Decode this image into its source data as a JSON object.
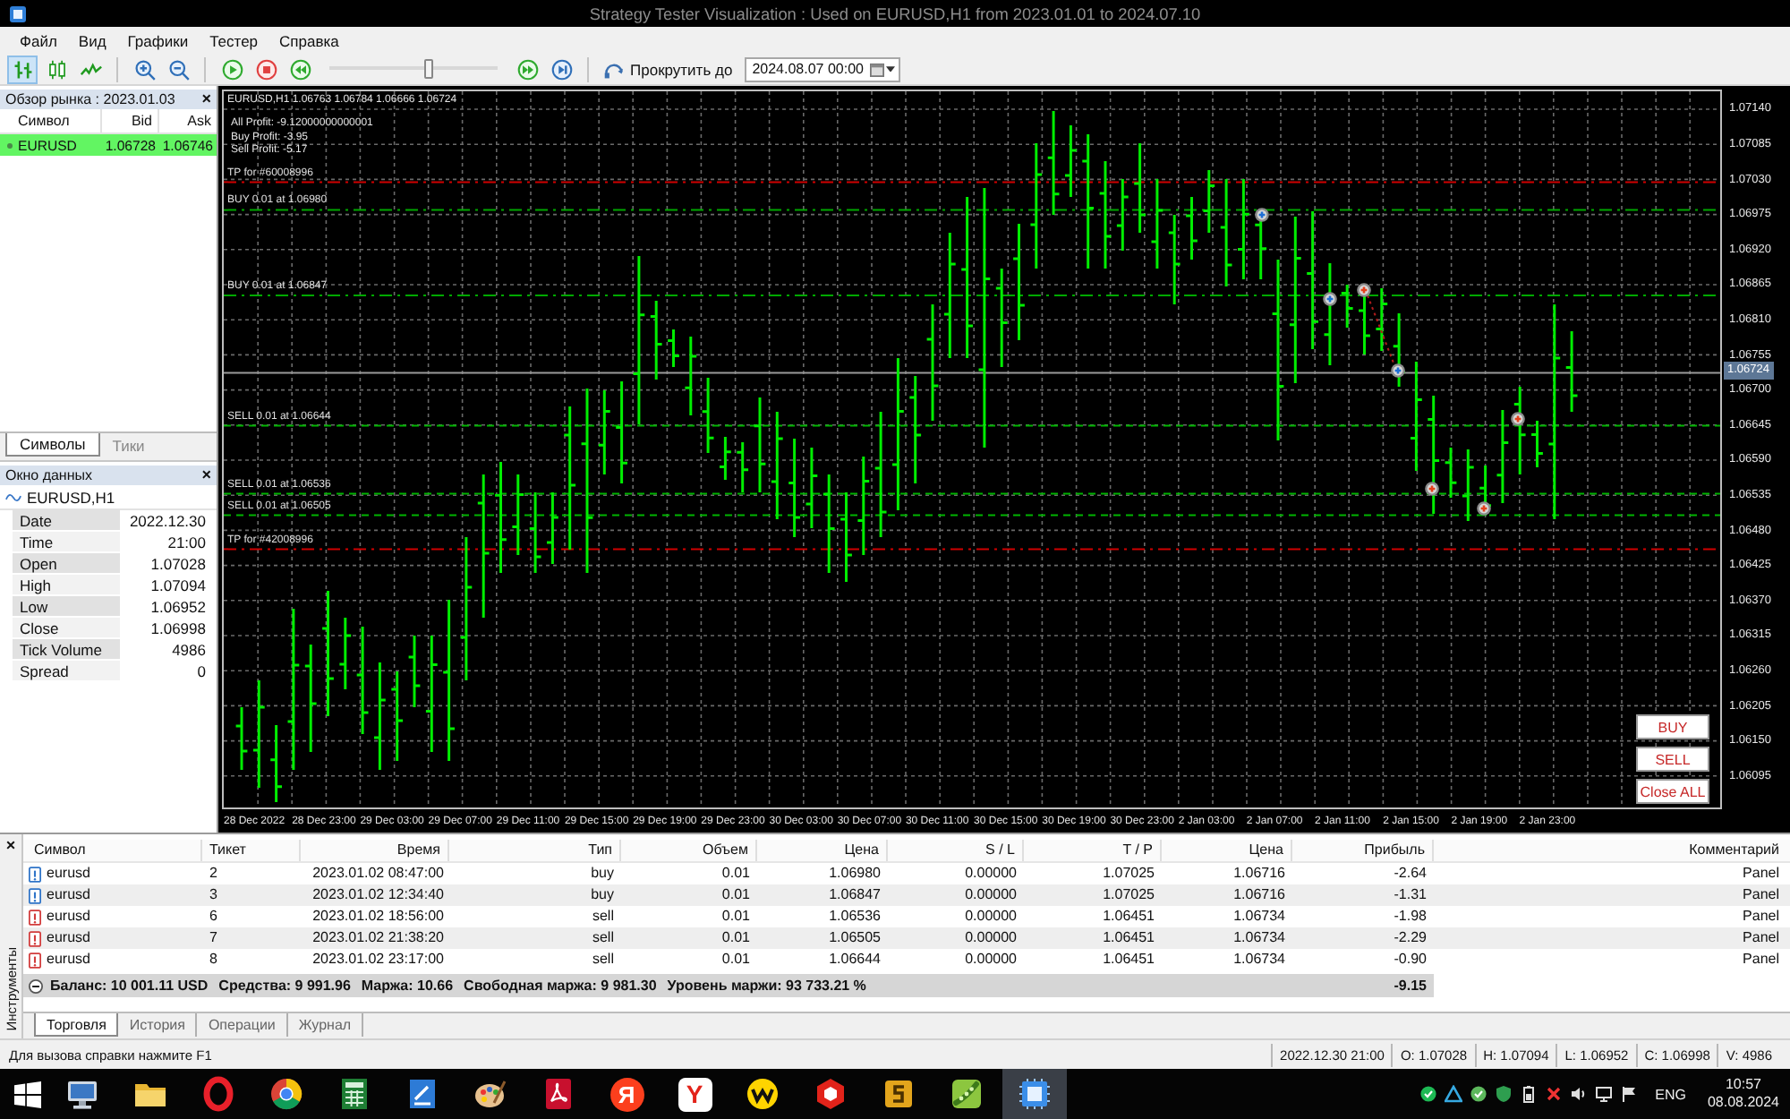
{
  "window": {
    "title": "Strategy Tester Visualization : Used on EURUSD,H1 from 2023.01.01 to 2024.07.10"
  },
  "menu": [
    "Файл",
    "Вид",
    "Графики",
    "Тестер",
    "Справка"
  ],
  "toolbar": {
    "chart_modes": [
      {
        "kind": "bars",
        "selected": true
      },
      {
        "kind": "candles",
        "selected": false
      },
      {
        "kind": "line",
        "selected": false
      }
    ],
    "speed": {
      "level": 0.6
    },
    "scroll_to": {
      "label": "Прокрутить до",
      "value": "2024.08.07 00:00"
    }
  },
  "market_watch": {
    "title": "Обзор рынка : 2023.01.03",
    "close": "×",
    "columns": [
      "Символ",
      "Bid",
      "Ask"
    ],
    "rows": [
      {
        "symbol": "EURUSD",
        "bid": "1.06728",
        "ask": "1.06746",
        "selected": true
      }
    ],
    "tabs": [
      {
        "label": "Символы",
        "selected": true
      },
      {
        "label": "Тики",
        "selected": false
      }
    ]
  },
  "data_window": {
    "title": "Окно данных",
    "close": "×",
    "symbol": "EURUSD,H1",
    "rows": [
      {
        "label": "Date",
        "value": "2022.12.30"
      },
      {
        "label": "Time",
        "value": "21:00"
      },
      {
        "label": "Open",
        "value": "1.07028"
      },
      {
        "label": "High",
        "value": "1.07094"
      },
      {
        "label": "Low",
        "value": "1.06952"
      },
      {
        "label": "Close",
        "value": "1.06998"
      },
      {
        "label": "Tick Volume",
        "value": "4986"
      },
      {
        "label": "Spread",
        "value": "0"
      }
    ]
  },
  "chart": {
    "header": "EURUSD,H1 1.06763 1.06784 1.06666 1.06724",
    "profit_lines": [
      "All Profit: -9.12000000000001",
      "Buy Profit: -3.95",
      "Sell Profit: -5.17"
    ],
    "order_lines": [
      {
        "kind": "tp",
        "label": "TP for #60008996"
      },
      {
        "kind": "buy",
        "label": "BUY 0.01 at 1.06980"
      },
      {
        "kind": "buy",
        "label": "BUY 0.01 at 1.06847"
      },
      {
        "kind": "sell",
        "label": "SELL 0.01 at 1.06644"
      },
      {
        "kind": "sell",
        "label": "SELL 0.01 at 1.06536"
      },
      {
        "kind": "sell",
        "label": "SELL 0.01 at 1.06505"
      },
      {
        "kind": "tp",
        "label": "TP for #42008996"
      }
    ],
    "current_price": "1.06724",
    "price_labels": [
      "1.07140",
      "1.07085",
      "1.07030",
      "1.06975",
      "1.06920",
      "1.06865",
      "1.06810",
      "1.06755",
      "1.06700",
      "1.06645",
      "1.06590",
      "1.06535",
      "1.06480",
      "1.06425",
      "1.06370",
      "1.06315",
      "1.06260",
      "1.06205",
      "1.06150",
      "1.06095"
    ],
    "time_labels": [
      "28 Dec 2022",
      "28 Dec 23:00",
      "29 Dec 03:00",
      "29 Dec 07:00",
      "29 Dec 11:00",
      "29 Dec 15:00",
      "29 Dec 19:00",
      "29 Dec 23:00",
      "30 Dec 03:00",
      "30 Dec 07:00",
      "30 Dec 11:00",
      "30 Dec 15:00",
      "30 Dec 19:00",
      "30 Dec 23:00",
      "2 Jan 03:00",
      "2 Jan 07:00",
      "2 Jan 11:00",
      "2 Jan 15:00",
      "2 Jan 19:00",
      "2 Jan 23:00"
    ],
    "buttons": [
      "BUY",
      "SELL",
      "Close ALL"
    ]
  },
  "terminal": {
    "close": "×",
    "side_label": "Инструменты",
    "columns": [
      "Символ",
      "Тикет",
      "Время",
      "Тип",
      "Объем",
      "Цена",
      "S / L",
      "T / P",
      "Цена",
      "Прибыль",
      "Комментарий"
    ],
    "rows": [
      {
        "kind": "buy",
        "symbol": "eurusd",
        "ticket": "2",
        "time": "2023.01.02 08:47:00",
        "type": "buy",
        "volume": "0.01",
        "price": "1.06980",
        "sl": "0.00000",
        "tp": "1.07025",
        "current_price": "1.06716",
        "profit": "-2.64",
        "comment": "Panel"
      },
      {
        "kind": "buy",
        "symbol": "eurusd",
        "ticket": "3",
        "time": "2023.01.02 12:34:40",
        "type": "buy",
        "volume": "0.01",
        "price": "1.06847",
        "sl": "0.00000",
        "tp": "1.07025",
        "current_price": "1.06716",
        "profit": "-1.31",
        "comment": "Panel"
      },
      {
        "kind": "sell",
        "symbol": "eurusd",
        "ticket": "6",
        "time": "2023.01.02 18:56:00",
        "type": "sell",
        "volume": "0.01",
        "price": "1.06536",
        "sl": "0.00000",
        "tp": "1.06451",
        "current_price": "1.06734",
        "profit": "-1.98",
        "comment": "Panel"
      },
      {
        "kind": "sell",
        "symbol": "eurusd",
        "ticket": "7",
        "time": "2023.01.02 21:38:20",
        "type": "sell",
        "volume": "0.01",
        "price": "1.06505",
        "sl": "0.00000",
        "tp": "1.06451",
        "current_price": "1.06734",
        "profit": "-2.29",
        "comment": "Panel"
      },
      {
        "kind": "sell",
        "symbol": "eurusd",
        "ticket": "8",
        "time": "2023.01.02 23:17:00",
        "type": "sell",
        "volume": "0.01",
        "price": "1.06644",
        "sl": "0.00000",
        "tp": "1.06451",
        "current_price": "1.06734",
        "profit": "-0.90",
        "comment": "Panel"
      }
    ],
    "summary": [
      "Баланс: 10 001.11 USD",
      "Средства: 9 991.96",
      "Маржа: 10.66",
      "Свободная маржа: 9 981.30",
      "Уровень маржи: 93 733.21 %"
    ],
    "total": "-9.15",
    "tabs": [
      {
        "label": "Торговля",
        "selected": true
      },
      {
        "label": "История",
        "selected": false
      },
      {
        "label": "Операции",
        "selected": false
      },
      {
        "label": "Журнал",
        "selected": false
      }
    ]
  },
  "status_bar": {
    "hint": "Для вызова справки нажмите F1",
    "fields": [
      "2022.12.30 21:00",
      "O: 1.07028",
      "H: 1.07094",
      "L: 1.06952",
      "C: 1.06998",
      "V: 4986"
    ]
  },
  "taskbar": {
    "apps": [
      {
        "kind": "computer",
        "selected": false
      },
      {
        "kind": "folder",
        "selected": false
      },
      {
        "kind": "ring",
        "selected": false
      },
      {
        "kind": "segmented_circle",
        "selected": false
      },
      {
        "kind": "calculator",
        "selected": false
      },
      {
        "kind": "document",
        "selected": false
      },
      {
        "kind": "palette",
        "selected": false
      },
      {
        "kind": "pdf",
        "selected": false
      },
      {
        "kind": "letter_circle",
        "letter": "Я",
        "selected": false
      },
      {
        "kind": "letter_tile",
        "letter": "Y",
        "selected": false
      },
      {
        "kind": "zigzag_circle",
        "selected": false
      },
      {
        "kind": "hexagon",
        "selected": false
      },
      {
        "kind": "tile",
        "selected": false
      },
      {
        "kind": "pea",
        "selected": false
      },
      {
        "kind": "chip",
        "selected": true
      }
    ],
    "language": "ENG",
    "time": "10:57",
    "date": "08.08.2024"
  }
}
